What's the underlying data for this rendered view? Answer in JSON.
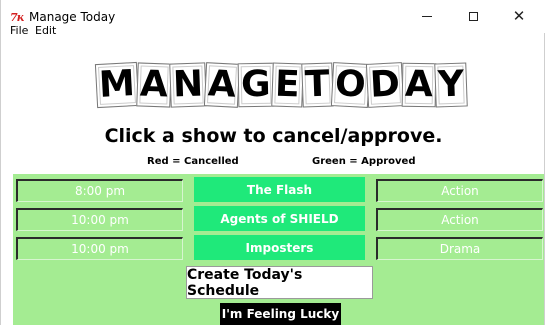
{
  "window": {
    "title": "Manage Today",
    "icon_text": "7ĸ"
  },
  "menu": {
    "file": "File",
    "edit": "Edit"
  },
  "header": {
    "logo_text": "MANAGE TODAY",
    "instruction": "Click a show to cancel/approve.",
    "legend_red": "Red = Cancelled",
    "legend_green": "Green = Approved"
  },
  "schedule": {
    "rows": [
      {
        "time": "8:00 pm",
        "show": "The Flash",
        "genre": "Action"
      },
      {
        "time": "10:00 pm",
        "show": "Agents of SHIELD",
        "genre": "Action"
      },
      {
        "time": "10:00 pm",
        "show": "Imposters",
        "genre": "Drama"
      }
    ]
  },
  "buttons": {
    "create": "Create Today's Schedule",
    "lucky": "I'm Feeling Lucky"
  },
  "colors": {
    "background_green": "#a4ec92",
    "approved_green": "#1fe97a",
    "app_icon_red": "#d42020"
  }
}
